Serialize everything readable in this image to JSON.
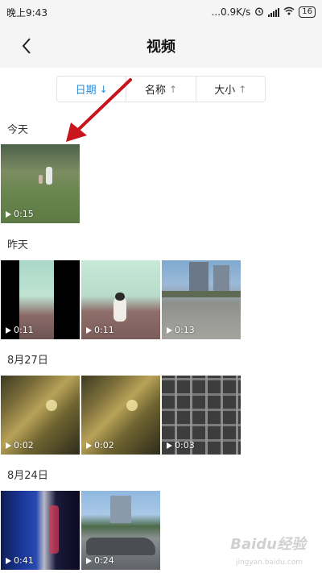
{
  "status_bar": {
    "time": "晚上9:43",
    "speed": "...0.9K/s",
    "battery": "16"
  },
  "header": {
    "title": "视频"
  },
  "sort": {
    "tabs": [
      {
        "label": "日期",
        "arrow": "↓",
        "active": true
      },
      {
        "label": "名称",
        "arrow": "↑",
        "active": false
      },
      {
        "label": "大小",
        "arrow": "↑",
        "active": false
      }
    ]
  },
  "sections": [
    {
      "label": "今天",
      "videos": [
        "0:15"
      ]
    },
    {
      "label": "昨天",
      "videos": [
        "0:11",
        "0:11",
        "0:13"
      ]
    },
    {
      "label": "8月27日",
      "videos": [
        "0:02",
        "0:02",
        "0:03"
      ]
    },
    {
      "label": "8月24日",
      "videos": [
        "0:41",
        "0:24"
      ]
    }
  ],
  "watermark": {
    "text": "Baidu经验",
    "sub": "jingyan.baidu.com"
  }
}
